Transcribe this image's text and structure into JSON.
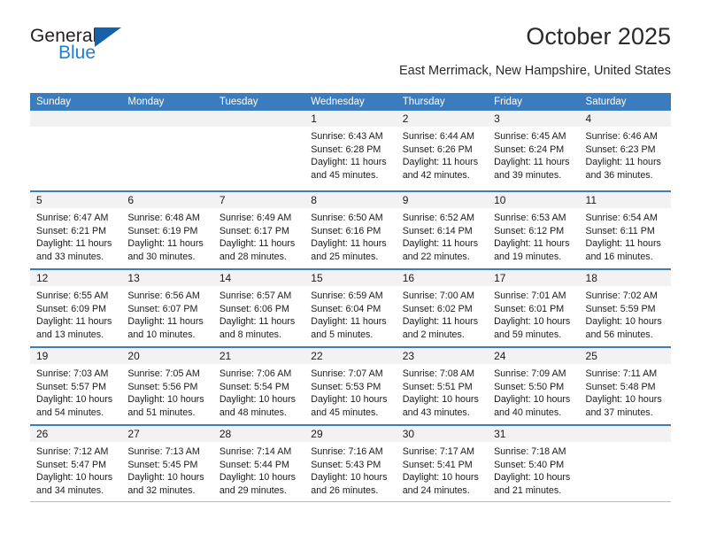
{
  "brand": {
    "line1": "General",
    "line2": "Blue",
    "triangle_color": "#1562a8",
    "blue_text_color": "#1f7fd0"
  },
  "header": {
    "title": "October 2025",
    "subtitle": "East Merrimack, New Hampshire, United States"
  },
  "theme": {
    "header_blue": "#3b7cbe",
    "date_strip_gray": "#f2f2f2",
    "text_color": "#1a1a1a"
  },
  "calendar": {
    "weekdays": [
      "Sunday",
      "Monday",
      "Tuesday",
      "Wednesday",
      "Thursday",
      "Friday",
      "Saturday"
    ],
    "weeks": [
      [
        {
          "day": "",
          "empty": true
        },
        {
          "day": "",
          "empty": true
        },
        {
          "day": "",
          "empty": true
        },
        {
          "day": "1",
          "sunrise": "Sunrise: 6:43 AM",
          "sunset": "Sunset: 6:28 PM",
          "daylight": "Daylight: 11 hours and 45 minutes."
        },
        {
          "day": "2",
          "sunrise": "Sunrise: 6:44 AM",
          "sunset": "Sunset: 6:26 PM",
          "daylight": "Daylight: 11 hours and 42 minutes."
        },
        {
          "day": "3",
          "sunrise": "Sunrise: 6:45 AM",
          "sunset": "Sunset: 6:24 PM",
          "daylight": "Daylight: 11 hours and 39 minutes."
        },
        {
          "day": "4",
          "sunrise": "Sunrise: 6:46 AM",
          "sunset": "Sunset: 6:23 PM",
          "daylight": "Daylight: 11 hours and 36 minutes."
        }
      ],
      [
        {
          "day": "5",
          "sunrise": "Sunrise: 6:47 AM",
          "sunset": "Sunset: 6:21 PM",
          "daylight": "Daylight: 11 hours and 33 minutes."
        },
        {
          "day": "6",
          "sunrise": "Sunrise: 6:48 AM",
          "sunset": "Sunset: 6:19 PM",
          "daylight": "Daylight: 11 hours and 30 minutes."
        },
        {
          "day": "7",
          "sunrise": "Sunrise: 6:49 AM",
          "sunset": "Sunset: 6:17 PM",
          "daylight": "Daylight: 11 hours and 28 minutes."
        },
        {
          "day": "8",
          "sunrise": "Sunrise: 6:50 AM",
          "sunset": "Sunset: 6:16 PM",
          "daylight": "Daylight: 11 hours and 25 minutes."
        },
        {
          "day": "9",
          "sunrise": "Sunrise: 6:52 AM",
          "sunset": "Sunset: 6:14 PM",
          "daylight": "Daylight: 11 hours and 22 minutes."
        },
        {
          "day": "10",
          "sunrise": "Sunrise: 6:53 AM",
          "sunset": "Sunset: 6:12 PM",
          "daylight": "Daylight: 11 hours and 19 minutes."
        },
        {
          "day": "11",
          "sunrise": "Sunrise: 6:54 AM",
          "sunset": "Sunset: 6:11 PM",
          "daylight": "Daylight: 11 hours and 16 minutes."
        }
      ],
      [
        {
          "day": "12",
          "sunrise": "Sunrise: 6:55 AM",
          "sunset": "Sunset: 6:09 PM",
          "daylight": "Daylight: 11 hours and 13 minutes."
        },
        {
          "day": "13",
          "sunrise": "Sunrise: 6:56 AM",
          "sunset": "Sunset: 6:07 PM",
          "daylight": "Daylight: 11 hours and 10 minutes."
        },
        {
          "day": "14",
          "sunrise": "Sunrise: 6:57 AM",
          "sunset": "Sunset: 6:06 PM",
          "daylight": "Daylight: 11 hours and 8 minutes."
        },
        {
          "day": "15",
          "sunrise": "Sunrise: 6:59 AM",
          "sunset": "Sunset: 6:04 PM",
          "daylight": "Daylight: 11 hours and 5 minutes."
        },
        {
          "day": "16",
          "sunrise": "Sunrise: 7:00 AM",
          "sunset": "Sunset: 6:02 PM",
          "daylight": "Daylight: 11 hours and 2 minutes."
        },
        {
          "day": "17",
          "sunrise": "Sunrise: 7:01 AM",
          "sunset": "Sunset: 6:01 PM",
          "daylight": "Daylight: 10 hours and 59 minutes."
        },
        {
          "day": "18",
          "sunrise": "Sunrise: 7:02 AM",
          "sunset": "Sunset: 5:59 PM",
          "daylight": "Daylight: 10 hours and 56 minutes."
        }
      ],
      [
        {
          "day": "19",
          "sunrise": "Sunrise: 7:03 AM",
          "sunset": "Sunset: 5:57 PM",
          "daylight": "Daylight: 10 hours and 54 minutes."
        },
        {
          "day": "20",
          "sunrise": "Sunrise: 7:05 AM",
          "sunset": "Sunset: 5:56 PM",
          "daylight": "Daylight: 10 hours and 51 minutes."
        },
        {
          "day": "21",
          "sunrise": "Sunrise: 7:06 AM",
          "sunset": "Sunset: 5:54 PM",
          "daylight": "Daylight: 10 hours and 48 minutes."
        },
        {
          "day": "22",
          "sunrise": "Sunrise: 7:07 AM",
          "sunset": "Sunset: 5:53 PM",
          "daylight": "Daylight: 10 hours and 45 minutes."
        },
        {
          "day": "23",
          "sunrise": "Sunrise: 7:08 AM",
          "sunset": "Sunset: 5:51 PM",
          "daylight": "Daylight: 10 hours and 43 minutes."
        },
        {
          "day": "24",
          "sunrise": "Sunrise: 7:09 AM",
          "sunset": "Sunset: 5:50 PM",
          "daylight": "Daylight: 10 hours and 40 minutes."
        },
        {
          "day": "25",
          "sunrise": "Sunrise: 7:11 AM",
          "sunset": "Sunset: 5:48 PM",
          "daylight": "Daylight: 10 hours and 37 minutes."
        }
      ],
      [
        {
          "day": "26",
          "sunrise": "Sunrise: 7:12 AM",
          "sunset": "Sunset: 5:47 PM",
          "daylight": "Daylight: 10 hours and 34 minutes."
        },
        {
          "day": "27",
          "sunrise": "Sunrise: 7:13 AM",
          "sunset": "Sunset: 5:45 PM",
          "daylight": "Daylight: 10 hours and 32 minutes."
        },
        {
          "day": "28",
          "sunrise": "Sunrise: 7:14 AM",
          "sunset": "Sunset: 5:44 PM",
          "daylight": "Daylight: 10 hours and 29 minutes."
        },
        {
          "day": "29",
          "sunrise": "Sunrise: 7:16 AM",
          "sunset": "Sunset: 5:43 PM",
          "daylight": "Daylight: 10 hours and 26 minutes."
        },
        {
          "day": "30",
          "sunrise": "Sunrise: 7:17 AM",
          "sunset": "Sunset: 5:41 PM",
          "daylight": "Daylight: 10 hours and 24 minutes."
        },
        {
          "day": "31",
          "sunrise": "Sunrise: 7:18 AM",
          "sunset": "Sunset: 5:40 PM",
          "daylight": "Daylight: 10 hours and 21 minutes."
        },
        {
          "day": "",
          "empty": true
        }
      ]
    ]
  }
}
